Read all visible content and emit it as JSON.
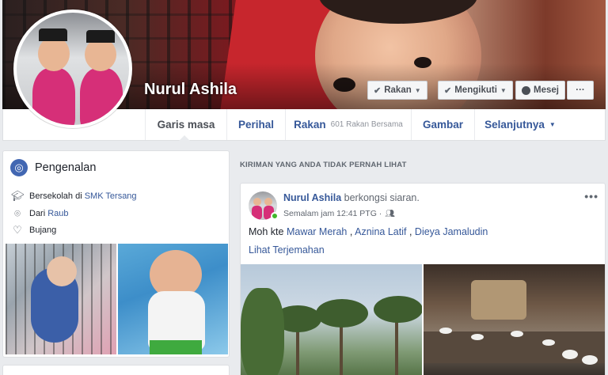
{
  "profile": {
    "name": "Nurul Ashila"
  },
  "cover_buttons": {
    "friends": "Rakan",
    "following": "Mengikuti",
    "message": "Mesej",
    "more": "···"
  },
  "nav": {
    "timeline": "Garis masa",
    "about": "Perihal",
    "friends": "Rakan",
    "friends_sub": "601 Rakan Bersama",
    "photos": "Gambar",
    "more": "Selanjutnya"
  },
  "intro": {
    "title": "Pengenalan",
    "school_prefix": "Bersekolah di",
    "school": "SMK Tersang",
    "from_prefix": "Dari",
    "from": "Raub",
    "relationship": "Bujang"
  },
  "feed": {
    "section_label": "KIRIMAN YANG ANDA TIDAK PERNAH LIHAT",
    "post": {
      "author": "Nurul Ashila",
      "action": "berkongsi siaran.",
      "time": "Semalam jam 12:41 PTG · ",
      "text_prefix": "Moh kte",
      "tag1": "Mawar Merah",
      "sep1": ",",
      "tag2": "Aznina Latif",
      "sep2": ",",
      "tag3": "Dieya Jamaludin",
      "translate": "Lihat Terjemahan",
      "menu": "•••"
    }
  },
  "icons": {
    "globe": "globe-icon",
    "school": "graduation-cap-icon",
    "location": "location-pin-icon",
    "heart": "heart-icon",
    "audience": "friends-audience-icon",
    "messenger": "messenger-icon"
  },
  "colors": {
    "link": "#365899",
    "brand": "#4267b2",
    "online": "#42b72a",
    "background": "#e9ebee"
  }
}
